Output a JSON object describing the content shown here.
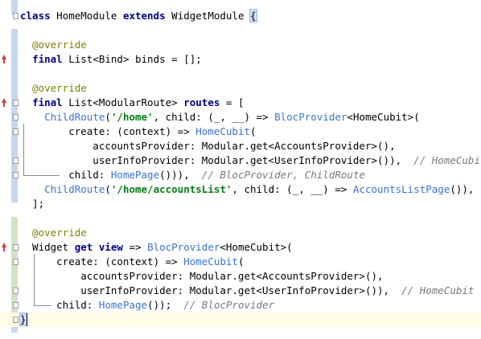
{
  "lines": [
    [
      {
        "t": "class",
        "c": "kw"
      },
      {
        "t": " HomeModule "
      },
      {
        "t": "extends",
        "c": "kw"
      },
      {
        "t": " WidgetModule "
      },
      {
        "t": "{",
        "c": "brace-hl"
      }
    ],
    [],
    [
      {
        "t": "  @override",
        "c": "ann"
      }
    ],
    [
      {
        "t": "  "
      },
      {
        "t": "final",
        "c": "kw"
      },
      {
        "t": " List<Bind> binds = [];"
      }
    ],
    [],
    [
      {
        "t": "  @override",
        "c": "ann"
      }
    ],
    [
      {
        "t": "  "
      },
      {
        "t": "final",
        "c": "kw"
      },
      {
        "t": " List<ModularRoute> "
      },
      {
        "t": "routes",
        "c": "kw"
      },
      {
        "t": " = ["
      }
    ],
    [
      {
        "t": "    "
      },
      {
        "t": "ChildRoute",
        "c": "fn"
      },
      {
        "t": "("
      },
      {
        "t": "'/home'",
        "c": "str"
      },
      {
        "t": ", child: (_, __) => "
      },
      {
        "t": "BlocProvider",
        "c": "fn"
      },
      {
        "t": "<HomeCubit>("
      }
    ],
    [
      {
        "t": "        create: (context) => "
      },
      {
        "t": "HomeCubit",
        "c": "fn"
      },
      {
        "t": "("
      }
    ],
    [
      {
        "t": "            accountsProvider: Modular.get<AccountsProvider>(),"
      }
    ],
    [
      {
        "t": "            userInfoProvider: Modular.get<UserInfoProvider>()),  "
      },
      {
        "t": "// HomeCubit",
        "c": "cm"
      }
    ],
    [
      {
        "t": "        child: "
      },
      {
        "t": "HomePage",
        "c": "fn"
      },
      {
        "t": "())),  "
      },
      {
        "t": "// BlocProvider, ChildRoute",
        "c": "cm"
      }
    ],
    [
      {
        "t": "    "
      },
      {
        "t": "ChildRoute",
        "c": "fn"
      },
      {
        "t": "("
      },
      {
        "t": "'/home/accountsList'",
        "c": "str"
      },
      {
        "t": ", child: (_, __) => "
      },
      {
        "t": "AccountsListPage",
        "c": "fn"
      },
      {
        "t": "()),"
      }
    ],
    [
      {
        "t": "  ];"
      }
    ],
    [],
    [
      {
        "t": "  @override",
        "c": "ann"
      }
    ],
    [
      {
        "t": "  Widget "
      },
      {
        "t": "get",
        "c": "kw"
      },
      {
        "t": " "
      },
      {
        "t": "view",
        "c": "kw"
      },
      {
        "t": " => "
      },
      {
        "t": "BlocProvider",
        "c": "fn"
      },
      {
        "t": "<HomeCubit>("
      }
    ],
    [
      {
        "t": "      create: (context) => "
      },
      {
        "t": "HomeCubit",
        "c": "fn"
      },
      {
        "t": "("
      }
    ],
    [
      {
        "t": "          accountsProvider: Modular.get<AccountsProvider>(),"
      }
    ],
    [
      {
        "t": "          userInfoProvider: Modular.get<UserInfoProvider>()),  "
      },
      {
        "t": "// HomeCubit",
        "c": "cm"
      }
    ],
    [
      {
        "t": "      child: "
      },
      {
        "t": "HomePage",
        "c": "fn"
      },
      {
        "t": "());  "
      },
      {
        "t": "// BlocProvider",
        "c": "cm"
      }
    ],
    [
      {
        "t": "}",
        "c": "brace-hl"
      }
    ]
  ],
  "gutter": {
    "override_icon_lines": [
      3,
      6,
      16
    ],
    "fold_marker_lines": [
      0,
      6,
      7,
      8,
      10,
      11,
      16,
      17,
      19,
      20,
      21
    ]
  }
}
